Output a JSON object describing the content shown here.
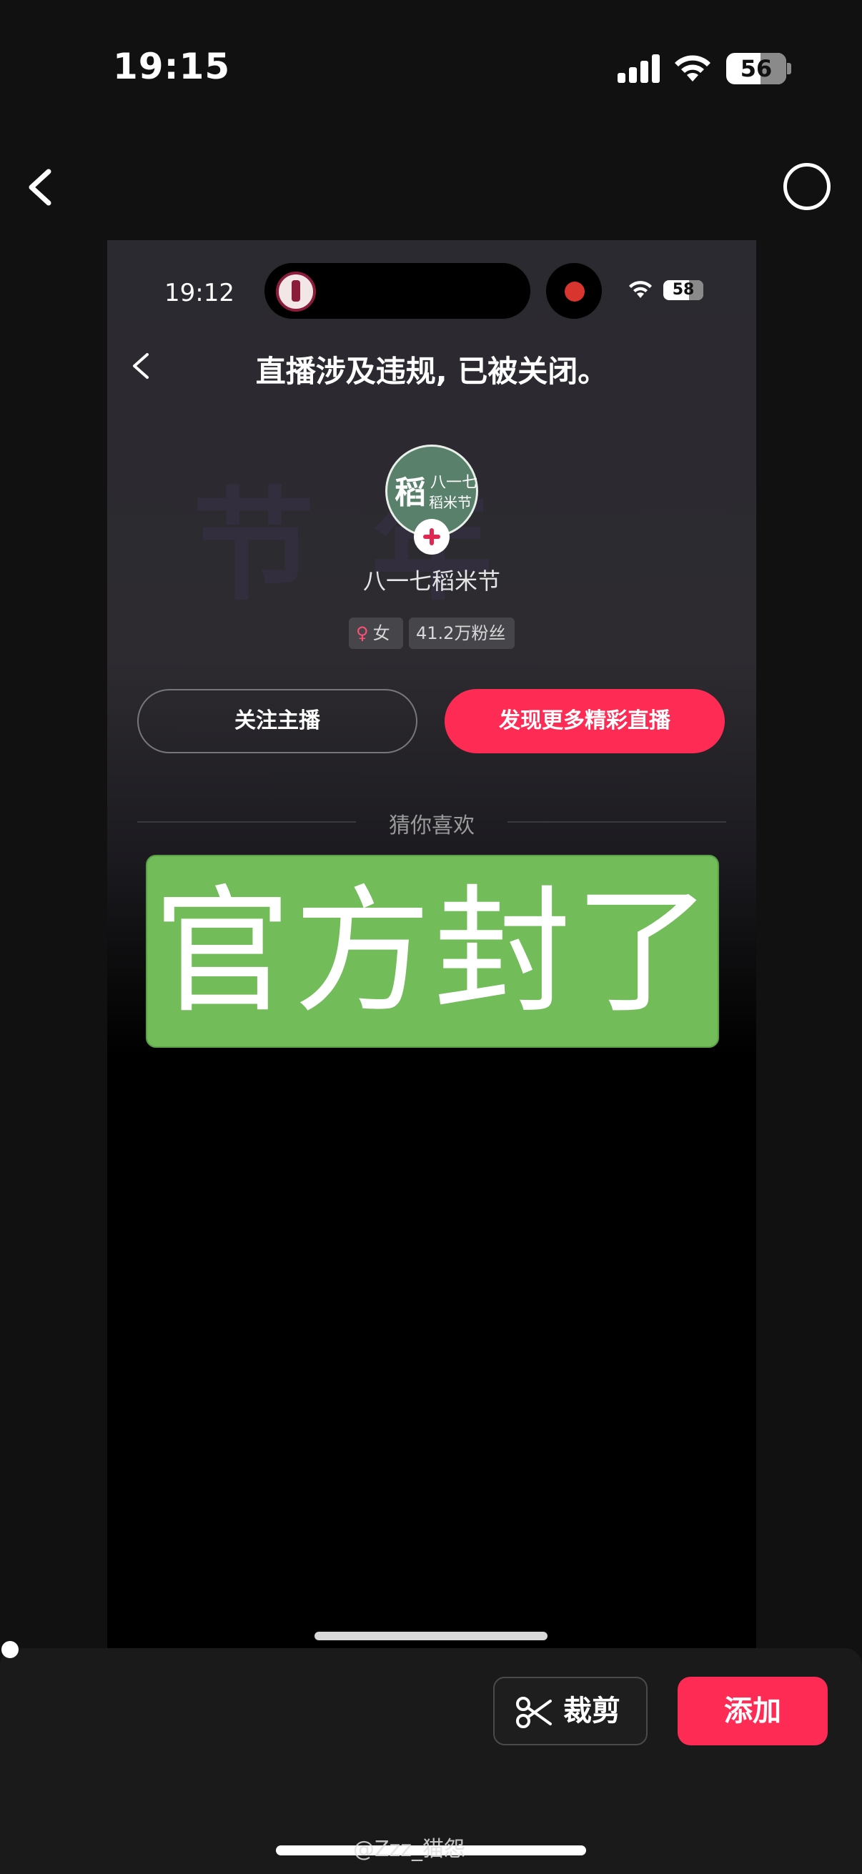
{
  "status_bar": {
    "time": "19:15",
    "battery": "56"
  },
  "inner": {
    "status_time": "19:12",
    "battery": "58",
    "title": "直播涉及违规, 已被关闭。",
    "avatar": {
      "logo_char": "稻",
      "name_line1": "八一七",
      "name_line2": "稻米节"
    },
    "username": "八一七稻米节",
    "tags": {
      "gender_symbol": "♀",
      "gender": "女",
      "fans": "41.2万粉丝"
    },
    "follow_label": "关注主播",
    "discover_label": "发现更多精彩直播",
    "guess_label": "猜你喜欢",
    "sticker_text": "官方封了"
  },
  "bottom": {
    "crop_label": "裁剪",
    "add_label": "添加"
  },
  "watermark": "@Zzz_猫怨",
  "colors": {
    "accent": "#fe2c55",
    "sticker": "#72bd5a",
    "background": "#111111"
  }
}
